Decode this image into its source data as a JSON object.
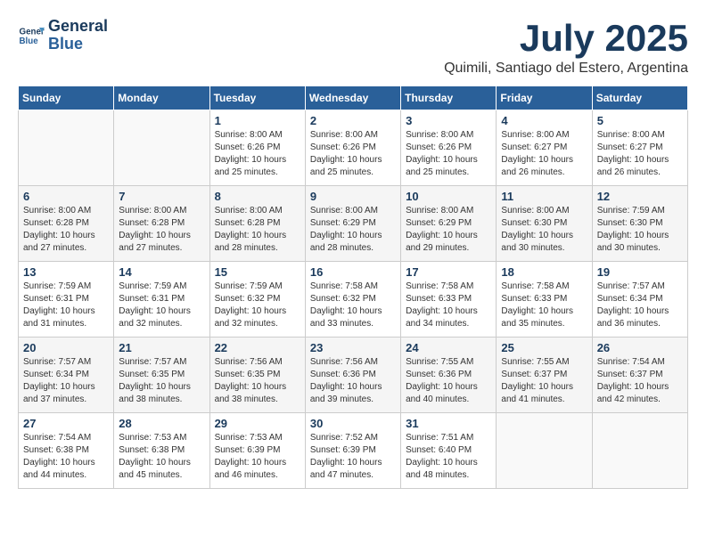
{
  "header": {
    "logo_line1": "General",
    "logo_line2": "Blue",
    "month": "July 2025",
    "location": "Quimili, Santiago del Estero, Argentina"
  },
  "days_of_week": [
    "Sunday",
    "Monday",
    "Tuesday",
    "Wednesday",
    "Thursday",
    "Friday",
    "Saturday"
  ],
  "weeks": [
    [
      {
        "day": "",
        "detail": ""
      },
      {
        "day": "",
        "detail": ""
      },
      {
        "day": "1",
        "detail": "Sunrise: 8:00 AM\nSunset: 6:26 PM\nDaylight: 10 hours\nand 25 minutes."
      },
      {
        "day": "2",
        "detail": "Sunrise: 8:00 AM\nSunset: 6:26 PM\nDaylight: 10 hours\nand 25 minutes."
      },
      {
        "day": "3",
        "detail": "Sunrise: 8:00 AM\nSunset: 6:26 PM\nDaylight: 10 hours\nand 25 minutes."
      },
      {
        "day": "4",
        "detail": "Sunrise: 8:00 AM\nSunset: 6:27 PM\nDaylight: 10 hours\nand 26 minutes."
      },
      {
        "day": "5",
        "detail": "Sunrise: 8:00 AM\nSunset: 6:27 PM\nDaylight: 10 hours\nand 26 minutes."
      }
    ],
    [
      {
        "day": "6",
        "detail": "Sunrise: 8:00 AM\nSunset: 6:28 PM\nDaylight: 10 hours\nand 27 minutes."
      },
      {
        "day": "7",
        "detail": "Sunrise: 8:00 AM\nSunset: 6:28 PM\nDaylight: 10 hours\nand 27 minutes."
      },
      {
        "day": "8",
        "detail": "Sunrise: 8:00 AM\nSunset: 6:28 PM\nDaylight: 10 hours\nand 28 minutes."
      },
      {
        "day": "9",
        "detail": "Sunrise: 8:00 AM\nSunset: 6:29 PM\nDaylight: 10 hours\nand 28 minutes."
      },
      {
        "day": "10",
        "detail": "Sunrise: 8:00 AM\nSunset: 6:29 PM\nDaylight: 10 hours\nand 29 minutes."
      },
      {
        "day": "11",
        "detail": "Sunrise: 8:00 AM\nSunset: 6:30 PM\nDaylight: 10 hours\nand 30 minutes."
      },
      {
        "day": "12",
        "detail": "Sunrise: 7:59 AM\nSunset: 6:30 PM\nDaylight: 10 hours\nand 30 minutes."
      }
    ],
    [
      {
        "day": "13",
        "detail": "Sunrise: 7:59 AM\nSunset: 6:31 PM\nDaylight: 10 hours\nand 31 minutes."
      },
      {
        "day": "14",
        "detail": "Sunrise: 7:59 AM\nSunset: 6:31 PM\nDaylight: 10 hours\nand 32 minutes."
      },
      {
        "day": "15",
        "detail": "Sunrise: 7:59 AM\nSunset: 6:32 PM\nDaylight: 10 hours\nand 32 minutes."
      },
      {
        "day": "16",
        "detail": "Sunrise: 7:58 AM\nSunset: 6:32 PM\nDaylight: 10 hours\nand 33 minutes."
      },
      {
        "day": "17",
        "detail": "Sunrise: 7:58 AM\nSunset: 6:33 PM\nDaylight: 10 hours\nand 34 minutes."
      },
      {
        "day": "18",
        "detail": "Sunrise: 7:58 AM\nSunset: 6:33 PM\nDaylight: 10 hours\nand 35 minutes."
      },
      {
        "day": "19",
        "detail": "Sunrise: 7:57 AM\nSunset: 6:34 PM\nDaylight: 10 hours\nand 36 minutes."
      }
    ],
    [
      {
        "day": "20",
        "detail": "Sunrise: 7:57 AM\nSunset: 6:34 PM\nDaylight: 10 hours\nand 37 minutes."
      },
      {
        "day": "21",
        "detail": "Sunrise: 7:57 AM\nSunset: 6:35 PM\nDaylight: 10 hours\nand 38 minutes."
      },
      {
        "day": "22",
        "detail": "Sunrise: 7:56 AM\nSunset: 6:35 PM\nDaylight: 10 hours\nand 38 minutes."
      },
      {
        "day": "23",
        "detail": "Sunrise: 7:56 AM\nSunset: 6:36 PM\nDaylight: 10 hours\nand 39 minutes."
      },
      {
        "day": "24",
        "detail": "Sunrise: 7:55 AM\nSunset: 6:36 PM\nDaylight: 10 hours\nand 40 minutes."
      },
      {
        "day": "25",
        "detail": "Sunrise: 7:55 AM\nSunset: 6:37 PM\nDaylight: 10 hours\nand 41 minutes."
      },
      {
        "day": "26",
        "detail": "Sunrise: 7:54 AM\nSunset: 6:37 PM\nDaylight: 10 hours\nand 42 minutes."
      }
    ],
    [
      {
        "day": "27",
        "detail": "Sunrise: 7:54 AM\nSunset: 6:38 PM\nDaylight: 10 hours\nand 44 minutes."
      },
      {
        "day": "28",
        "detail": "Sunrise: 7:53 AM\nSunset: 6:38 PM\nDaylight: 10 hours\nand 45 minutes."
      },
      {
        "day": "29",
        "detail": "Sunrise: 7:53 AM\nSunset: 6:39 PM\nDaylight: 10 hours\nand 46 minutes."
      },
      {
        "day": "30",
        "detail": "Sunrise: 7:52 AM\nSunset: 6:39 PM\nDaylight: 10 hours\nand 47 minutes."
      },
      {
        "day": "31",
        "detail": "Sunrise: 7:51 AM\nSunset: 6:40 PM\nDaylight: 10 hours\nand 48 minutes."
      },
      {
        "day": "",
        "detail": ""
      },
      {
        "day": "",
        "detail": ""
      }
    ]
  ]
}
